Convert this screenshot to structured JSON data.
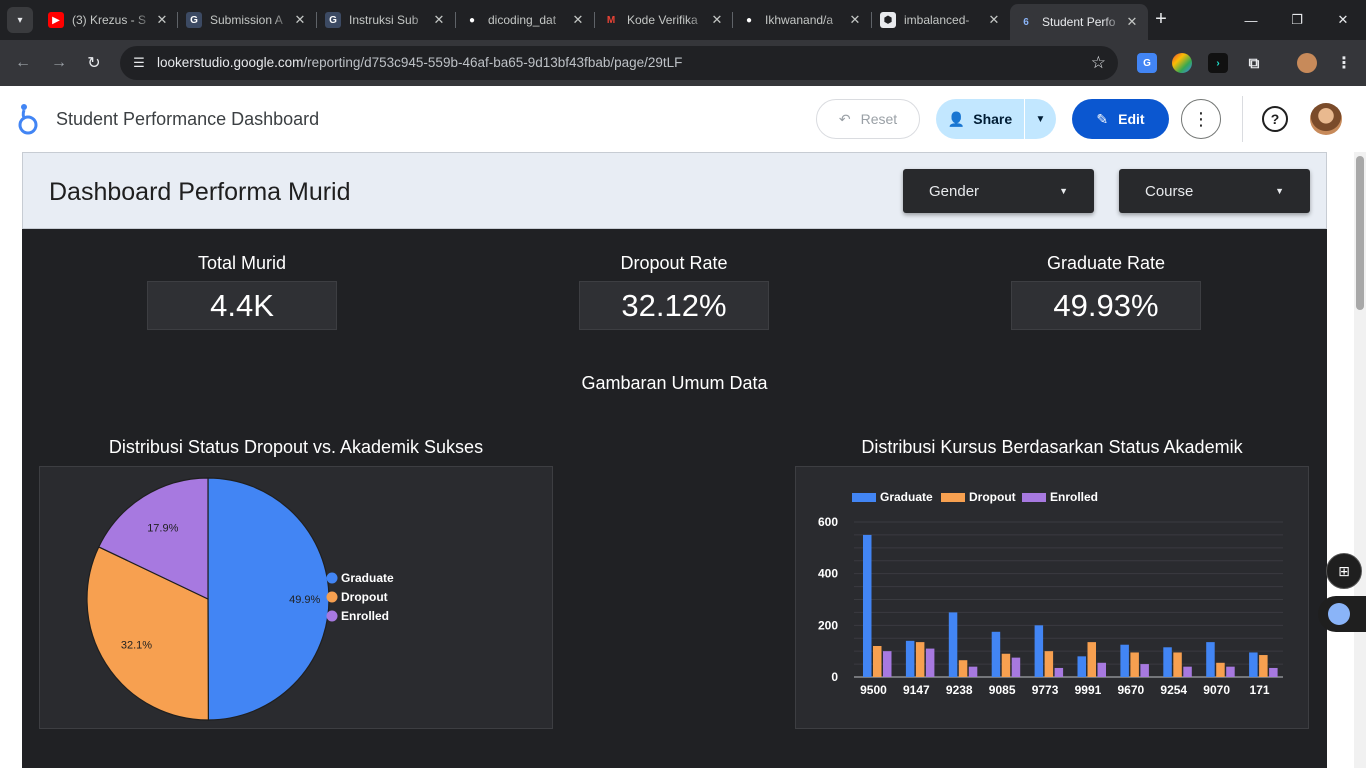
{
  "browser": {
    "tabs": [
      {
        "title": "(3) Krezus - S",
        "icon": "youtube-icon",
        "color": "#ff0000",
        "glyph": "▶"
      },
      {
        "title": "Submission A",
        "icon": "g-icon",
        "color": "#3c4a63",
        "glyph": "G"
      },
      {
        "title": "Instruksi Sub",
        "icon": "g-icon",
        "color": "#3c4a63",
        "glyph": "G"
      },
      {
        "title": "dicoding_dat",
        "icon": "github-icon",
        "color": "#202124",
        "glyph": "●"
      },
      {
        "title": "Kode Verifika",
        "icon": "gmail-icon",
        "color": "#202124",
        "glyph": "M"
      },
      {
        "title": "Ikhwanand/a",
        "icon": "github-icon",
        "color": "#202124",
        "glyph": "●"
      },
      {
        "title": "imbalanced-",
        "icon": "cube-icon",
        "color": "#e8eaed",
        "glyph": "⬢"
      },
      {
        "title": "Student Perfo",
        "icon": "looker-icon",
        "color": "#35363a",
        "glyph": "6"
      }
    ],
    "url_host": "lookerstudio.google.com",
    "url_path": "/reporting/d753c945-559b-46af-ba65-9d13bf43fbab/page/29tLF"
  },
  "app": {
    "title": "Student Performance Dashboard",
    "reset_label": "Reset",
    "share_label": "Share",
    "edit_label": "Edit"
  },
  "report": {
    "title": "Dashboard Performa Murid",
    "filters": [
      "Gender",
      "Course"
    ],
    "kpis": [
      {
        "label": "Total Murid",
        "value": "4.4K"
      },
      {
        "label": "Dropout Rate",
        "value": "32.12%"
      },
      {
        "label": "Graduate Rate",
        "value": "49.93%"
      }
    ],
    "section_title": "Gambaran Umum Data"
  },
  "colors": {
    "graduate": "#4285f4",
    "dropout": "#f7a050",
    "enrolled": "#a779e0"
  },
  "chart_data": [
    {
      "type": "pie",
      "title": "Distribusi Status Dropout vs. Akademik Sukses",
      "labels": [
        "Graduate",
        "Dropout",
        "Enrolled"
      ],
      "values": [
        49.9,
        32.1,
        17.9
      ],
      "value_labels": [
        "49.9%",
        "32.1%",
        "17.9%"
      ],
      "legend": "right"
    },
    {
      "type": "bar",
      "title": "Distribusi Kursus Berdasarkan Status Akademik",
      "categories": [
        "9500",
        "9147",
        "9238",
        "9085",
        "9773",
        "9991",
        "9670",
        "9254",
        "9070",
        "171"
      ],
      "series": [
        {
          "name": "Graduate",
          "values": [
            550,
            140,
            250,
            175,
            200,
            80,
            125,
            115,
            135,
            95
          ]
        },
        {
          "name": "Dropout",
          "values": [
            120,
            135,
            65,
            90,
            100,
            135,
            95,
            95,
            55,
            85
          ]
        },
        {
          "name": "Enrolled",
          "values": [
            100,
            110,
            40,
            75,
            35,
            55,
            50,
            40,
            40,
            35
          ]
        }
      ],
      "yticks": [
        "0",
        "200",
        "400",
        "600"
      ],
      "ylim": [
        0,
        600
      ],
      "legend": "top-left",
      "grid": true
    }
  ]
}
